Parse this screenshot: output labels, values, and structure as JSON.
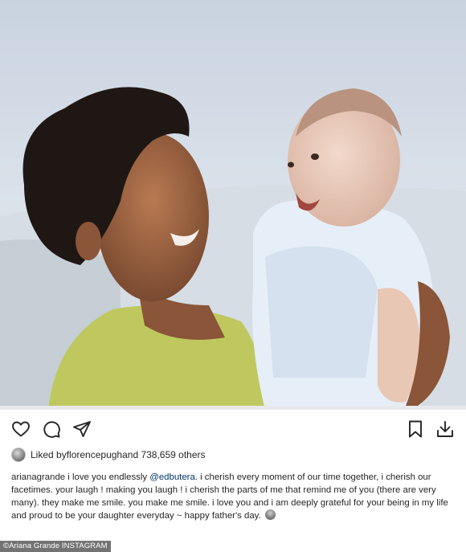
{
  "post": {
    "image_alt": "",
    "likes": {
      "prefix": "Liked by ",
      "user": "florencepugh",
      "suffix": " and 738,659 others"
    },
    "caption": {
      "username": "arianagrande",
      "part1": " i love you endlessly ",
      "mention": "@edbutera",
      "part2": ". i cherish every moment of our time together, i cherish our facetimes. your laugh ! making you laugh ! i cherish the parts of me that remind me of you (there are very many). they make me smile. you make me smile. i love you and i am deeply grateful for your being in my life and proud to be your daughter everyday ~ happy father's day. "
    },
    "icons": {
      "like": "heart-icon",
      "comment": "comment-icon",
      "share": "send-icon",
      "save": "bookmark-icon",
      "download": "download-icon"
    }
  },
  "credit": "©Ariana Grande INSTAGRAM"
}
